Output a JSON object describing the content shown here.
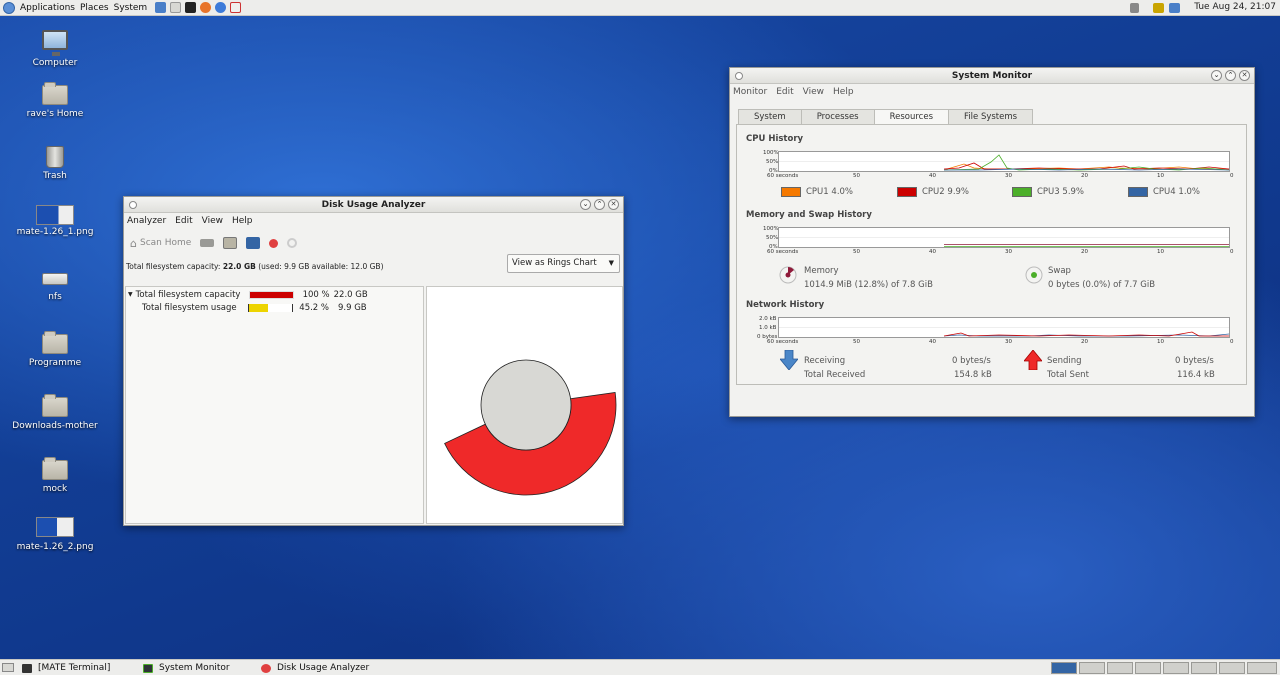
{
  "top_panel": {
    "menus": [
      "Applications",
      "Places",
      "System"
    ],
    "clock": "Tue Aug 24, 21:07"
  },
  "desktop_icons": [
    {
      "label": "Computer",
      "icon": "computer-icon"
    },
    {
      "label": "rave's Home",
      "icon": "home-folder-icon"
    },
    {
      "label": "Trash",
      "icon": "trash-icon"
    },
    {
      "label": "mate-1.26_1.png",
      "icon": "image-file-icon"
    },
    {
      "label": "nfs",
      "icon": "drive-icon"
    },
    {
      "label": "Programme",
      "icon": "folder-icon"
    },
    {
      "label": "Downloads-mother",
      "icon": "folder-icon"
    },
    {
      "label": "mock",
      "icon": "folder-icon"
    },
    {
      "label": "mate-1.26_2.png",
      "icon": "image-file-icon"
    }
  ],
  "disk_usage": {
    "title": "Disk Usage Analyzer",
    "menus": [
      "Analyzer",
      "Edit",
      "View",
      "Help"
    ],
    "scan_home": "Scan Home",
    "info_prefix": "Total filesystem capacity: ",
    "info_capacity": "22.0 GB",
    "info_rest": " (used: 9.9 GB available: 12.0 GB)",
    "view_mode": "View as Rings Chart",
    "rows": [
      {
        "name": "Total filesystem capacity",
        "percent": "100 %",
        "size": "22.0 GB",
        "fill": 1.0,
        "color": "#cc0000"
      },
      {
        "name": "Total filesystem usage",
        "percent": "45.2 %",
        "size": "9.9 GB",
        "fill": 0.452,
        "color": "#edd400"
      }
    ],
    "ring": {
      "fraction": 0.452,
      "center_color": "#d8d8d4",
      "ring_color": "#ef2929"
    }
  },
  "system_monitor": {
    "title": "System Monitor",
    "menus": [
      "Monitor",
      "Edit",
      "View",
      "Help"
    ],
    "tabs": [
      "System",
      "Processes",
      "Resources",
      "File Systems"
    ],
    "active_tab": "Resources",
    "cpu": {
      "title": "CPU History",
      "y_labels": [
        "100%",
        "50%",
        "0%"
      ],
      "x_labels": [
        "60 seconds",
        "50",
        "40",
        "30",
        "20",
        "10",
        "0"
      ],
      "legend": [
        {
          "label": "CPU1",
          "value": "4.0%",
          "color": "#f57900"
        },
        {
          "label": "CPU2",
          "value": "9.9%",
          "color": "#cc0000"
        },
        {
          "label": "CPU3",
          "value": "5.9%",
          "color": "#4caf2a"
        },
        {
          "label": "CPU4",
          "value": "1.0%",
          "color": "#3465a4"
        }
      ]
    },
    "memory": {
      "title": "Memory and Swap History",
      "y_labels": [
        "100%",
        "50%",
        "0%"
      ],
      "x_labels": [
        "60 seconds",
        "50",
        "40",
        "30",
        "20",
        "10",
        "0"
      ],
      "mem_label": "Memory",
      "mem_value": "1014.9 MiB (12.8%) of 7.8 GiB",
      "mem_color": "#8f1a3a",
      "swap_label": "Swap",
      "swap_value": "0 bytes (0.0%) of 7.7 GiB",
      "swap_color": "#4caf2a"
    },
    "network": {
      "title": "Network History",
      "y_labels": [
        "2.0 kB",
        "1.0 kB",
        "0 bytes"
      ],
      "x_labels": [
        "60 seconds",
        "50",
        "40",
        "30",
        "20",
        "10",
        "0"
      ],
      "receiving_label": "Receiving",
      "receiving_value": "0 bytes/s",
      "total_received_label": "Total Received",
      "total_received_value": "154.8 kB",
      "sending_label": "Sending",
      "sending_value": "0 bytes/s",
      "total_sent_label": "Total Sent",
      "total_sent_value": "116.4 kB"
    }
  },
  "taskbar": {
    "items": [
      "[MATE Terminal]",
      "System Monitor",
      "Disk Usage Analyzer"
    ]
  }
}
